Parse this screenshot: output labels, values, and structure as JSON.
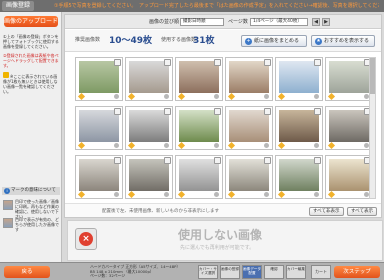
{
  "header": {
    "title": "画像登録",
    "notice": "①手順5で写真を登録してください。　アップロード完了したら最後まで「はた画像の作成予定」を入れてください→確認後、写真を選択してください"
  },
  "sidebar": {
    "upload_label": "画像のアップロード",
    "help": [
      "①上の「画像の登録」ボタンを押してフォトブックに使用する画像を登録してください。",
      "②登録された画像は表紙や各ページへドラッグして配置できます。",
      "※ここに表示されている画像が1枚も無いときは使用しない画像一覧を確認してください。"
    ],
    "mark_header": "マークの意味について",
    "marks": [
      {
        "text": "目印で使った画像／画像に印刷。再もなど作業の確認に、使用しないで下さい"
      },
      {
        "text": "目印で表示が有効の、どちらが使用したか画像です"
      }
    ]
  },
  "toolbar": {
    "sort_label": "画像の並び順",
    "sort_value": "撮影日時順",
    "page_label": "ページ数",
    "page_value": "1/4ページ（最大40枚）",
    "prev": "◀",
    "next": "▶"
  },
  "counts": {
    "recommended_label": "推奨画像数",
    "recommended_value": "10〜49枚",
    "used_label": "使用する画像数",
    "used_value": "31枚",
    "bulk_add_label": "紙に画像をまとめる",
    "recommend_label": "おすすめを表示する"
  },
  "grid": {
    "footer_hint": "配置後で左、未使用画像、新しいものから非表示にします",
    "hide_all_label": "すべて非表示",
    "show_all_label": "すべて表示"
  },
  "unused": {
    "title": "使用しない画像",
    "subtitle": "先に選んでも再利用が可能です。"
  },
  "bottombar": {
    "back_label": "戻る",
    "status": [
      "ハードカバータイプ 正方形（A5サイズ、14〜48P）",
      "B5 148 x 210mm （最大10000p）",
      "ページ数：32ページ"
    ],
    "steps": [
      {
        "label": "カバー・サイズ選択"
      },
      {
        "label": "画像の登録"
      },
      {
        "label": "画像データ配置"
      },
      {
        "label": "確認"
      },
      {
        "label": "カバー編集"
      }
    ],
    "cart_label": "カート",
    "next_label": "次ステップ"
  },
  "photo_colors": [
    [
      "#b8c7a4",
      "#7e9a64"
    ],
    [
      "#d9d9d9",
      "#a59a8e"
    ],
    [
      "#cfbfae",
      "#8d6f5d"
    ],
    [
      "#e2d7c8",
      "#9b7d66"
    ],
    [
      "#dfe7f1",
      "#8eb0cf"
    ],
    [
      "#d8ddd1",
      "#9ea49a"
    ],
    [
      "#d6d8dc",
      "#8d96a4"
    ],
    [
      "#dadada",
      "#7d7d7d"
    ],
    [
      "#d4e0c7",
      "#6e8b4d"
    ],
    [
      "#e1d8cf",
      "#a88f78"
    ],
    [
      "#c7b59b",
      "#6e5a49"
    ],
    [
      "#cac5bd",
      "#6e6a64"
    ],
    [
      "#d9d6cf",
      "#8c857c"
    ],
    [
      "#c5c4bc",
      "#716d66"
    ],
    [
      "#e0e0e0",
      "#939393"
    ],
    [
      "#e2e0d8",
      "#8c877c"
    ],
    [
      "#d1d7cc",
      "#6f8060"
    ],
    [
      "#ece4cf",
      "#aa926f"
    ],
    [
      "#d8d8d8",
      "#777777"
    ],
    [
      "#d3d9e0",
      "#7f8f9e"
    ],
    [
      "#cad7c0",
      "#60794c"
    ],
    [
      "#e5e9ef",
      "#9ba7b6"
    ]
  ]
}
